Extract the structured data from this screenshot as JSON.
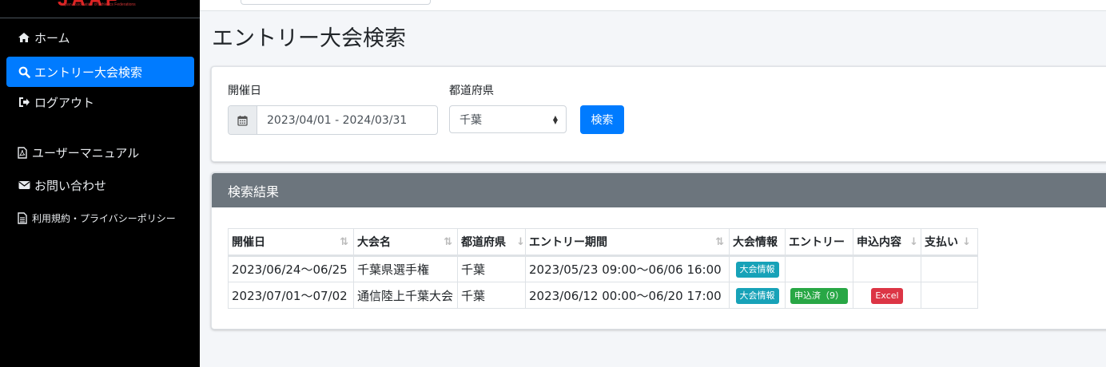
{
  "logo": {
    "text": "JAAF",
    "subtitle": "Japan Association of Athletics Federations"
  },
  "sidebar": {
    "items": [
      {
        "label": "ホーム",
        "icon": "home-icon"
      },
      {
        "label": "エントリー大会検索",
        "icon": "search-icon",
        "active": true
      },
      {
        "label": "ログアウト",
        "icon": "logout-icon"
      },
      {
        "label": "ユーザーマニュアル",
        "icon": "pdf-icon"
      },
      {
        "label": "お問い合わせ",
        "icon": "envelope-icon"
      },
      {
        "label": "利用規約・プライバシーポリシー",
        "icon": "document-icon"
      }
    ]
  },
  "page_title": "エントリー大会検索",
  "search": {
    "date_label": "開催日",
    "date_value": "2023/04/01 - 2024/03/31",
    "pref_label": "都道府県",
    "pref_value": "千葉",
    "button_label": "検索"
  },
  "results": {
    "header": "検索結果",
    "columns": [
      "開催日",
      "大会名",
      "都道府県",
      "エントリー期間",
      "大会情報",
      "エントリー",
      "申込内容",
      "支払い"
    ],
    "rows": [
      {
        "date": "2023/06/24～06/25",
        "name": "千葉県選手権",
        "pref": "千葉",
        "period": "2023/05/23 09:00～06/06 16:00",
        "info": "大会情報",
        "entry": "",
        "content": "",
        "payment": ""
      },
      {
        "date": "2023/07/01～07/02",
        "name": "通信陸上千葉大会",
        "pref": "千葉",
        "period": "2023/06/12 00:00～06/20 17:00",
        "info": "大会情報",
        "entry": "申込済（9）",
        "content": "Excel",
        "payment": ""
      }
    ]
  },
  "colors": {
    "primary": "#007bff",
    "info": "#17a2b8",
    "success": "#28a745",
    "danger": "#dc3545",
    "header_gray": "#6c757d"
  }
}
